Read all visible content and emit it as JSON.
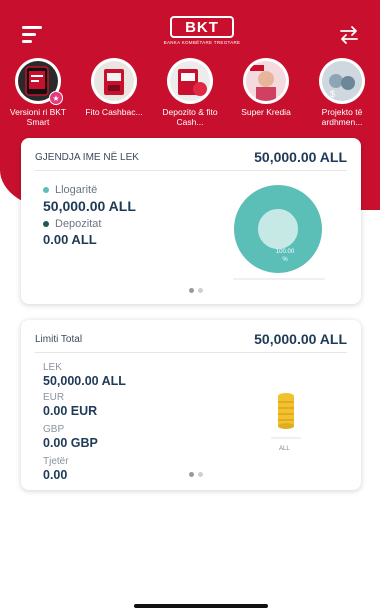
{
  "header": {
    "logo_text": "BKT",
    "logo_subtitle": "BANKA KOMBËTARE TREGTARE"
  },
  "stories": [
    {
      "label": "Versioni ri BKT Smart"
    },
    {
      "label": "Fito Cashbac..."
    },
    {
      "label": "Depozito & fito Cash..."
    },
    {
      "label": "Super Kredia"
    },
    {
      "label": "Projekto të ardhmen..."
    }
  ],
  "balance_card": {
    "title": "GJENDJA IME NË LEK",
    "total": "50,000.00 ALL",
    "accounts_label": "Llogaritë",
    "accounts_amount": "50,000.00 ALL",
    "deposits_label": "Depozitat",
    "deposits_amount": "0.00 ALL",
    "donut_value": "100.00",
    "donut_unit": "%",
    "accounts_color": "#5bbfb7",
    "deposits_color": "#1f5a4e"
  },
  "limit_card": {
    "title": "Limiti Total",
    "total": "50,000.00 ALL",
    "items": [
      {
        "currency": "LEK",
        "amount": "50,000.00 ALL"
      },
      {
        "currency": "EUR",
        "amount": "0.00 EUR"
      },
      {
        "currency": "GBP",
        "amount": "0.00 GBP"
      },
      {
        "currency": "Tjetër",
        "amount": "0.00"
      }
    ],
    "coins_label": "ALL",
    "coins_color": "#f2c12e"
  },
  "colors": {
    "brand": "#c8102e",
    "text_dark": "#1f3a57"
  }
}
